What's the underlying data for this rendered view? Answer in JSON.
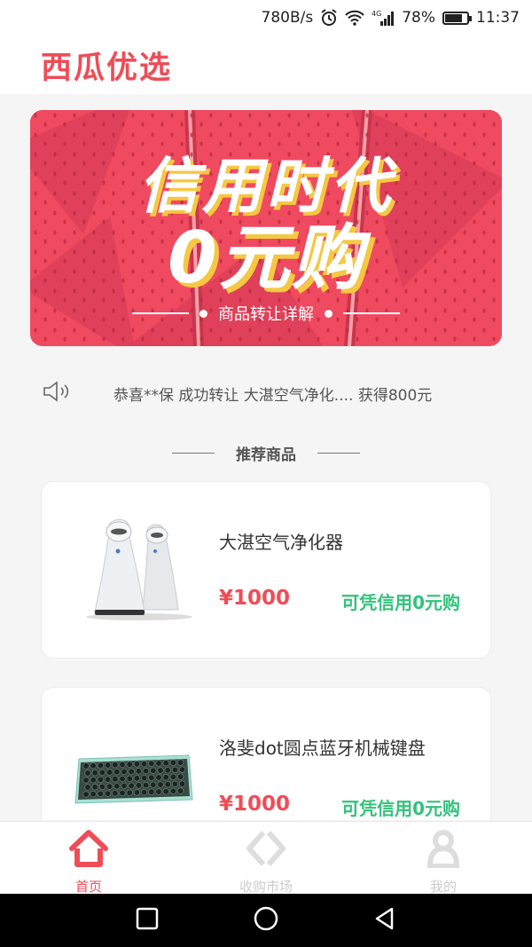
{
  "status_bar": {
    "network_speed": "780B/s",
    "network_type": "4G",
    "battery": "78%",
    "battery_level": 0.78,
    "time": "11:37",
    "icons": [
      "alarm-icon",
      "wifi-icon",
      "signal-icon",
      "battery-icon"
    ]
  },
  "header": {
    "title": "西瓜优选",
    "accent_color": "#ee4d57"
  },
  "banner": {
    "line1": "信用时代",
    "line2": "0元购",
    "link_label": "商品转让详解",
    "background_color": "#f04a60"
  },
  "notice": {
    "icon": "speaker-icon",
    "text": "恭喜**保 成功转让 大湛空气净化.... 获得800元"
  },
  "section": {
    "title": "推荐商品"
  },
  "products": [
    {
      "name": "大湛空气净化器",
      "price": "¥1000",
      "credit_label": "可凭信用0元购",
      "image": "air-purifier-image"
    },
    {
      "name": "洛斐dot圆点蓝牙机械键盘",
      "price": "¥1000",
      "credit_label": "可凭信用0元购",
      "image": "keyboard-image"
    }
  ],
  "tabbar": {
    "tabs": [
      {
        "label": "首页",
        "icon": "home-icon",
        "active": true
      },
      {
        "label": "收购市场",
        "icon": "market-icon",
        "active": false
      },
      {
        "label": "我的",
        "icon": "profile-icon",
        "active": false
      }
    ]
  },
  "colors": {
    "price": "#ee4d57",
    "credit": "#33c27c",
    "inactive_tab": "#cccccc"
  }
}
